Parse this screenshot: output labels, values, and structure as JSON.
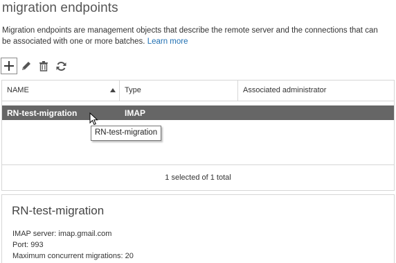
{
  "page": {
    "title": "migration endpoints",
    "description_line1": "Migration endpoints are management objects that describe the remote server and the connections that can",
    "description_line2": "be associated with one or more batches.",
    "learn_more": "Learn more"
  },
  "toolbar": {
    "icons": [
      "add-icon",
      "edit-icon",
      "delete-icon",
      "refresh-icon"
    ]
  },
  "table": {
    "columns": [
      "NAME",
      "Type",
      "Associated administrator"
    ],
    "sorted_column": "NAME",
    "rows": [
      {
        "name": "RN-test-migration",
        "type": "IMAP",
        "admin": ""
      }
    ],
    "status": "1 selected of 1 total"
  },
  "tooltip": {
    "text": "RN-test-migration"
  },
  "details": {
    "title": "RN-test-migration",
    "imap_server": "IMAP server: imap.gmail.com",
    "port": "Port: 993",
    "max_concurrent": "Maximum concurrent migrations: 20"
  },
  "colors": {
    "selected_row": "#666666",
    "link": "#1f6fb2",
    "border": "#d6d6d6"
  }
}
